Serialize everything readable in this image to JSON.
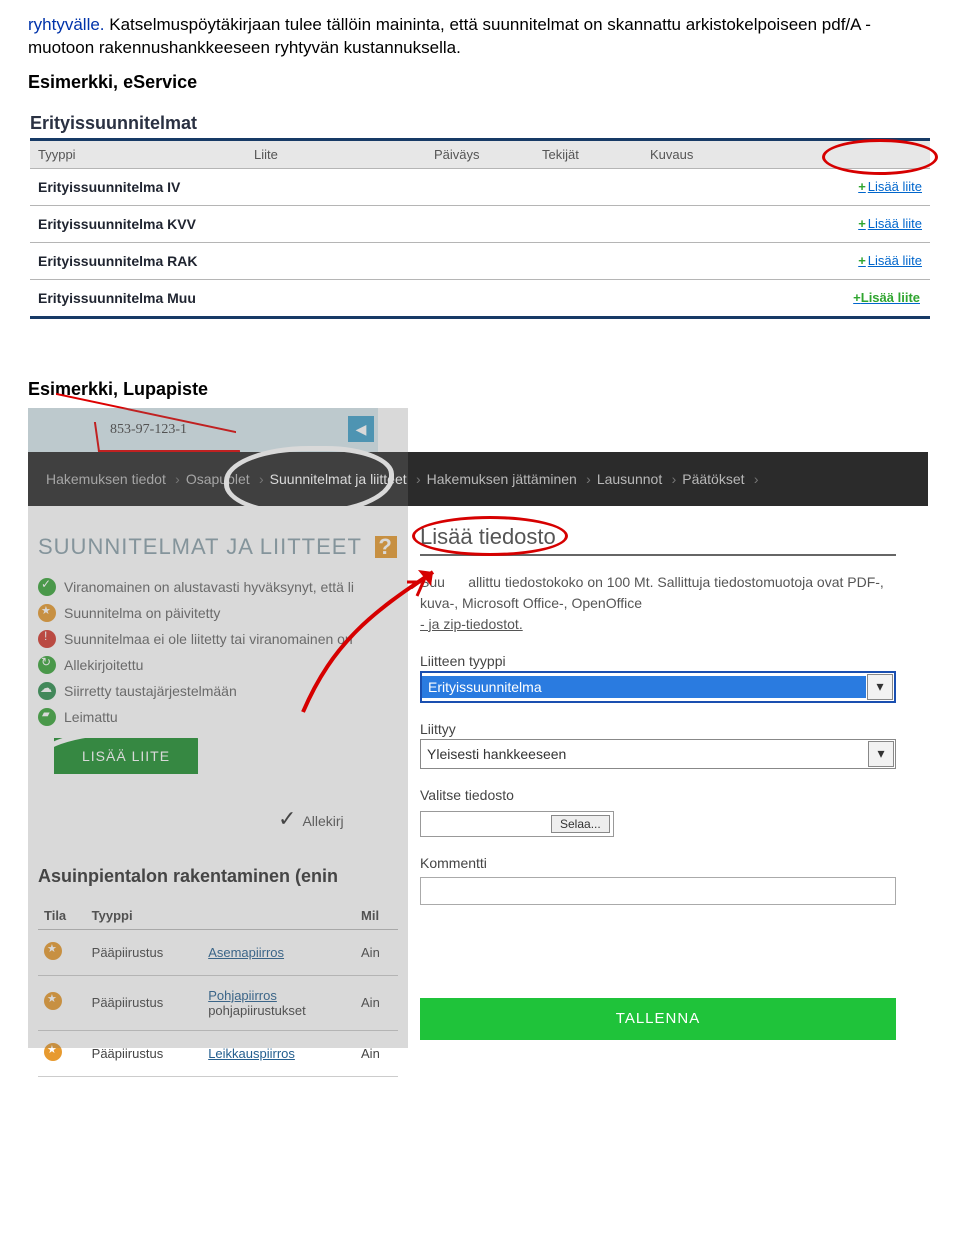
{
  "intro": {
    "first_word": "ryhtyvälle.",
    "rest": "Katselmuspöytäkirjaan tulee tällöin maininta, että suunnitelmat on skannattu arkistokelpoiseen pdf/A -muotoon rakennushankkeeseen ryhtyvän kustannuksella."
  },
  "headings": {
    "eservice": "Esimerkki, eService",
    "lupapiste": "Esimerkki, Lupapiste"
  },
  "eservice": {
    "section_title": "Erityissuunnitelmat",
    "columns": [
      "Tyyppi",
      "Liite",
      "Päiväys",
      "Tekijät",
      "Kuvaus",
      ""
    ],
    "rows": [
      {
        "type": "Erityissuunnitelma IV",
        "link": "Lisää liite"
      },
      {
        "type": "Erityissuunnitelma KVV",
        "link": "Lisää liite"
      },
      {
        "type": "Erityissuunnitelma RAK",
        "link": "Lisää liite"
      },
      {
        "type": "Erityissuunnitelma Muu",
        "link": "Lisää liite"
      }
    ]
  },
  "lupapiste": {
    "map_label": "853-97-123-1",
    "breadcrumbs": [
      "Hakemuksen tiedot",
      "Osapuolet",
      "Suunnitelmat ja liitteet",
      "Hakemuksen jättäminen",
      "Lausunnot",
      "Päätökset"
    ],
    "left": {
      "title": "SUUNNITELMAT JA LIITTEET",
      "legend": [
        "Viranomainen on alustavasti hyväksynyt, että li",
        "Suunnitelma on päivitetty",
        "Suunnitelmaa ei ole liitetty tai viranomainen on",
        "Allekirjoitettu",
        "Siirretty taustajärjestelmään",
        "Leimattu"
      ],
      "add_button": "LISÄÄ LIITE",
      "sign_label": "Allekirj",
      "subtitle": "Asuinpientalon rakentaminen (enin",
      "table": {
        "headers": [
          "Tila",
          "Tyyppi",
          "",
          "Mil"
        ],
        "rows": [
          {
            "type": "Pääpiirustus",
            "link": "Asemapiirros",
            "mil": "Ain"
          },
          {
            "type": "Pääpiirustus",
            "link": "Pohjapiirros",
            "sub": "pohjapiirustukset",
            "mil": "Ain"
          },
          {
            "type": "Pääpiirustus",
            "link": "Leikkauspiirros",
            "mil": "Ain"
          }
        ]
      }
    },
    "dialog": {
      "title": "Lisää tiedosto",
      "desc_pre": "Suu",
      "desc_main": "allittu tiedostokoko on 100 Mt. Sallittuja tiedostomuotoja ovat PDF-, kuva-, Microsoft Office-, OpenOffice",
      "desc_under": "- ja zip-tiedostot.",
      "label_type": "Liitteen tyyppi",
      "type_value": "Erityissuunnitelma",
      "label_rel": "Liittyy",
      "rel_value": "Yleisesti hankkeeseen",
      "label_file": "Valitse tiedosto",
      "browse": "Selaa...",
      "label_comment": "Kommentti",
      "save": "TALLENNA"
    }
  }
}
